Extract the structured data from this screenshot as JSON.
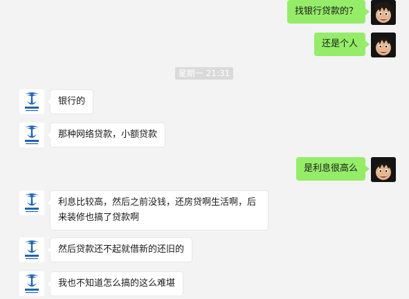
{
  "messages": [
    {
      "side": "right",
      "text": "找银行贷款的？",
      "avatar": "anime-avatar"
    },
    {
      "side": "right",
      "text": "还是个人",
      "avatar": "anime-avatar"
    },
    {
      "side": "left",
      "text": "银行的",
      "avatar": "china-telecom-avatar"
    },
    {
      "side": "left",
      "text": "那种网络贷款，小额贷款",
      "avatar": "china-telecom-avatar"
    },
    {
      "side": "right",
      "text": "是利息很高么",
      "avatar": "anime-avatar"
    },
    {
      "side": "left",
      "text": "利息比较高，然后之前没钱，还房贷啊生活啊，后来装修也搞了贷款啊",
      "avatar": "china-telecom-avatar"
    },
    {
      "side": "left",
      "text": "然后贷款还不起就借新的还旧的",
      "avatar": "china-telecom-avatar"
    },
    {
      "side": "left",
      "text": "我也不知道怎么搞的这么难堪",
      "avatar": "china-telecom-avatar"
    }
  ],
  "timestamp": "星期一 21:31",
  "colors": {
    "background": "#f3f3f3",
    "bubble_self": "#95ec69",
    "bubble_other": "#ffffff",
    "timestamp_bg": "#dadada",
    "telecom_blue": "#1d63b4"
  }
}
